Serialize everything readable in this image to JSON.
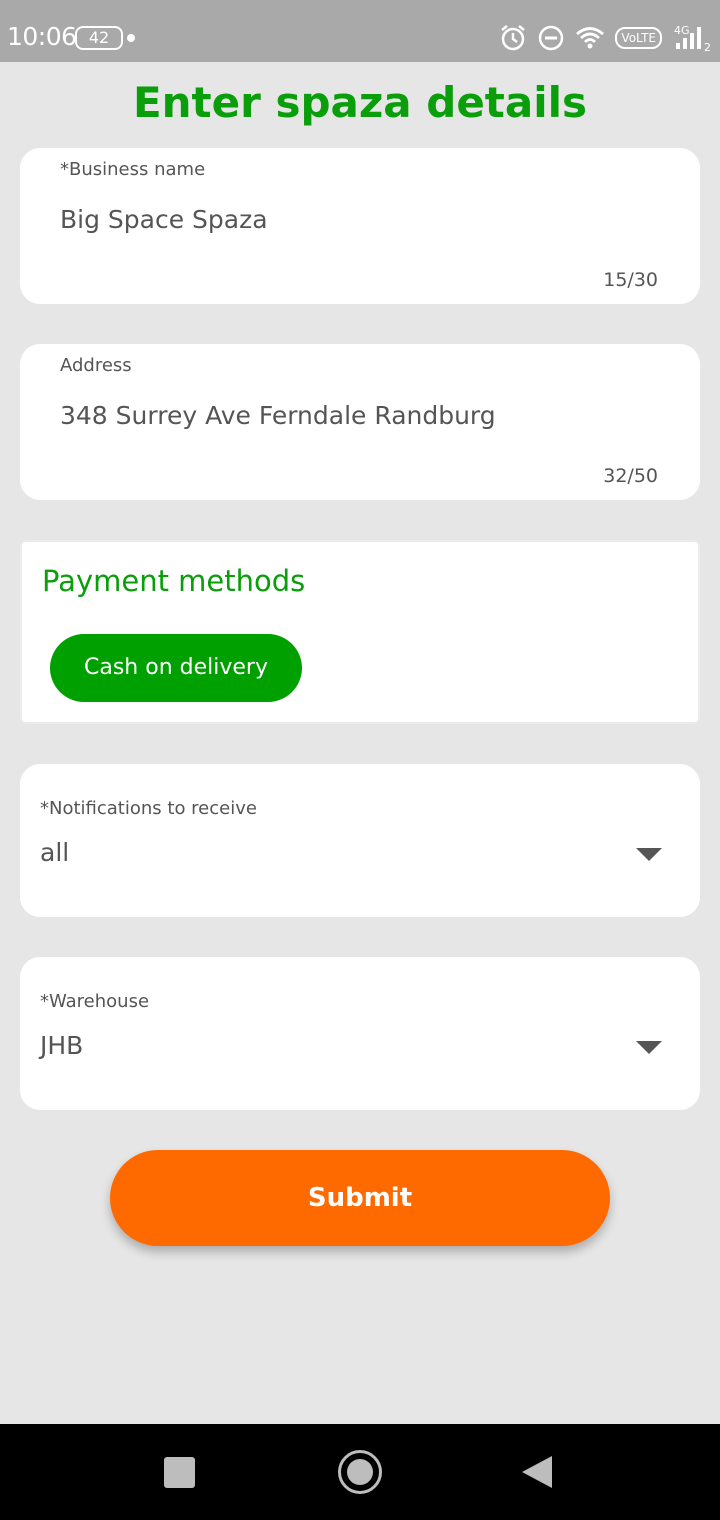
{
  "status_bar": {
    "time": "10:06",
    "battery": "42",
    "network_badge": "VoLTE",
    "network_type": "4G",
    "sim_index": "2",
    "icons": [
      "alarm-icon",
      "do-not-disturb-icon",
      "wifi-icon",
      "volte-icon",
      "signal-icon"
    ]
  },
  "page": {
    "title": "Enter spaza details",
    "accent_color": "#0a9e0a",
    "submit_color": "#ff6a00"
  },
  "business_name": {
    "label": "*Business name",
    "value": "Big Space Spaza",
    "counter": "15/30"
  },
  "address": {
    "label": "Address",
    "value": "348 Surrey Ave Ferndale Randburg",
    "counter": "32/50"
  },
  "payment": {
    "title": "Payment methods",
    "chips": [
      "Cash on delivery"
    ]
  },
  "notifications": {
    "label": "*Notifications to receive",
    "value": "all"
  },
  "warehouse": {
    "label": "*Warehouse",
    "value": "JHB"
  },
  "submit": {
    "label": "Submit"
  },
  "nav_bar": {
    "icons": [
      "recents-square-icon",
      "home-circle-icon",
      "back-triangle-icon"
    ]
  }
}
